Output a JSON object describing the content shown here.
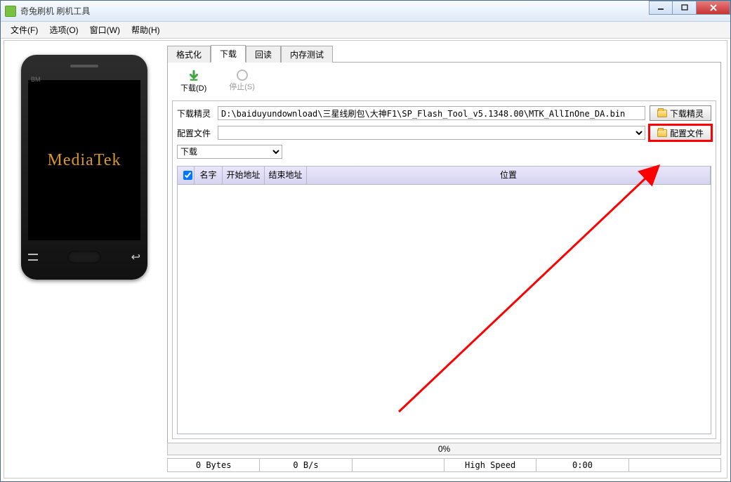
{
  "titlebar": {
    "title": "奇兔刷机 刷机工具"
  },
  "menubar": {
    "file": "文件(F)",
    "options": "选项(O)",
    "window": "窗口(W)",
    "help": "帮助(H)"
  },
  "phone": {
    "brand": "MediaTek",
    "label_bm": "BM"
  },
  "tabs": {
    "format": "格式化",
    "download": "下载",
    "readback": "回读",
    "memtest": "内存测试"
  },
  "toolbar": {
    "download": "下载(D)",
    "stop": "停止(S)"
  },
  "form": {
    "wizard_label": "下载精灵",
    "wizard_path": "D:\\baiduyundownload\\三星线刷包\\大神F1\\SP_Flash_Tool_v5.1348.00\\MTK_AllInOne_DA.bin",
    "wizard_btn": "下载精灵",
    "config_label": "配置文件",
    "config_value": "",
    "config_btn": "配置文件",
    "mode_select": "下载"
  },
  "grid": {
    "headers": {
      "name": "名字",
      "start": "开始地址",
      "end": "结束地址",
      "location": "位置"
    }
  },
  "status": {
    "progress_pct": "0%",
    "bytes": "0 Bytes",
    "speed": "0 B/s",
    "mode": "High Speed",
    "time": "0:00"
  }
}
